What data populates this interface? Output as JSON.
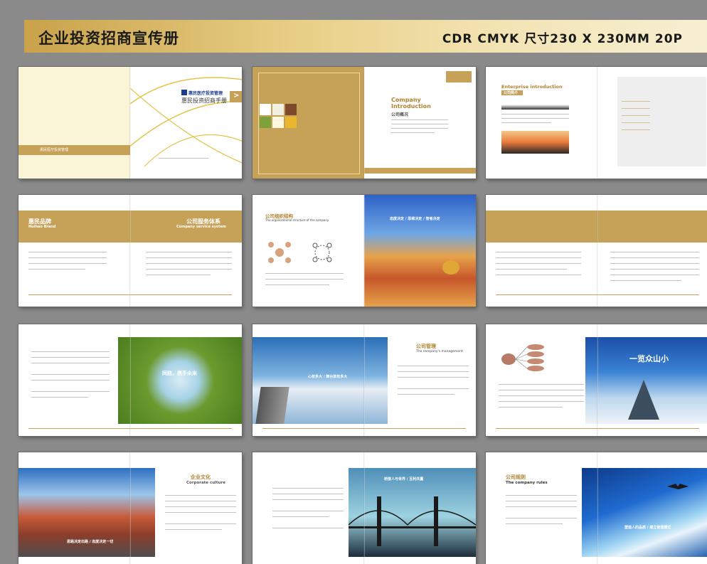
{
  "banner": {
    "title": "企业投资招商宣传册",
    "spec": "CDR  CMYK  尺寸230 X 230MM  20P"
  },
  "spreads": {
    "s1": {
      "brand": "惠民医疗投资管理",
      "subtitle": "惠民投资招商手册",
      "arrow": ">",
      "left_company": "惠民医疗投资管理"
    },
    "s2": {
      "title1": "Company",
      "title2": "Introduction",
      "sub": "公司概况"
    },
    "s3": {
      "title": "Enterprise introduction",
      "sub": "公司简介"
    },
    "s4": {
      "left_title": "惠民品牌",
      "left_sub": "Huihao Brand",
      "right_title": "公司服务体系",
      "right_sub": "Company service system"
    },
    "s5": {
      "title": "公司组织结构",
      "sub": "The organizational structure of the company",
      "slogan1": "态度决定 / 思维决定 / 智者决定"
    },
    "s7": {
      "slogan": "同路，携手未来"
    },
    "s8": {
      "title": "公司管理",
      "sub": "The company's management",
      "slogan": "心有多大 / 舞台就有多大"
    },
    "s9": {
      "slogan": "一览众山小"
    },
    "s10": {
      "title": "企业文化",
      "sub": "Corporate culture",
      "slogan": "思路决定出路 / 态度决定一切"
    },
    "s11": {
      "slogan": "桥接人与世界 / 互利共赢"
    },
    "s12": {
      "title": "公司规则",
      "sub": "The company rules",
      "slogan": "塑造人的品质 / 建立管理模式"
    }
  }
}
